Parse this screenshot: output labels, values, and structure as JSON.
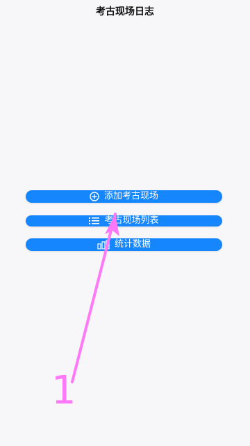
{
  "app_title": "考古现场日志",
  "buttons": {
    "add": {
      "label": "添加考古现场",
      "icon": "plus-circle-icon"
    },
    "list": {
      "label": "考古现场列表",
      "icon": "list-icon"
    },
    "stats": {
      "label": "统计数据",
      "icon": "bar-chart-icon"
    }
  },
  "annotation": {
    "number": "1",
    "color": "#ff78f7"
  },
  "colors": {
    "accent": "#1686ff",
    "background": "#f7f7f9"
  }
}
